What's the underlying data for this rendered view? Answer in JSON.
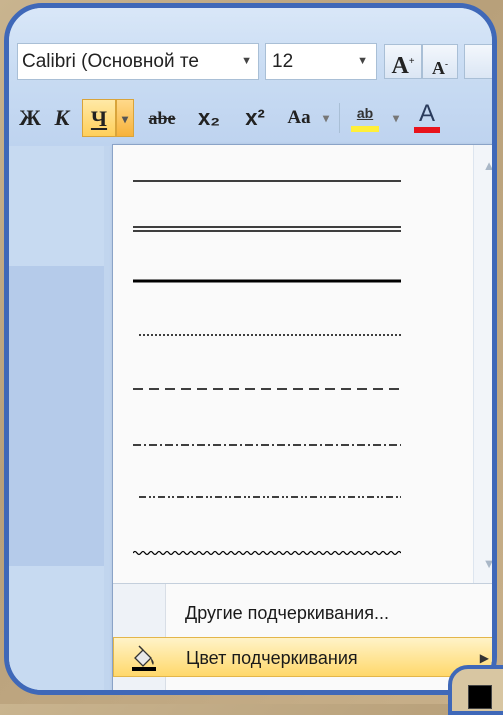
{
  "toolbar": {
    "font_name": "Calibri (Основной те",
    "font_size": "12",
    "dropdown_arrow": "▼",
    "grow_label": "A",
    "grow_sup": "+",
    "shrink_label": "A",
    "shrink_sup": "-"
  },
  "format": {
    "bold": "Ж",
    "italic": "К",
    "underline": "Ч",
    "underline_arrow": "▾",
    "strike": "abe",
    "subscript": "x₂",
    "superscript": "x²",
    "change_case": "Aa",
    "change_case_arrow": "▾",
    "highlight": "ab",
    "highlight_arrow": "▾",
    "font_color": "A"
  },
  "underline_menu": {
    "styles": [
      "single",
      "double",
      "thick",
      "dotted",
      "dashed",
      "dash-dot",
      "dash-dot-dot",
      "wave"
    ],
    "scroll_up": "▲",
    "scroll_down": "▼",
    "more_underlines": "Другие подчеркивания...",
    "underline_color": "Цвет подчеркивания",
    "submenu_arrow": "▶",
    "grip": "....",
    "selected_color": "#000000"
  },
  "colors": {
    "frame_border": "#3f68b8",
    "highlight_yellow": "#ffd86b",
    "font_color_red": "#e8121b"
  }
}
